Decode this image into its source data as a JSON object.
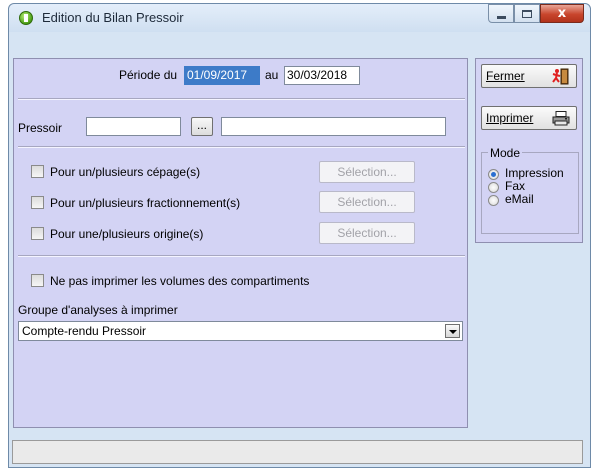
{
  "window": {
    "title": "Edition du Bilan Pressoir",
    "close_glyph": "x"
  },
  "periode": {
    "label_du": "Période du",
    "date_from": "01/09/2017",
    "label_au": "au",
    "date_to": "30/03/2018"
  },
  "pressoir": {
    "label": "Pressoir",
    "code_value": "",
    "browse_label": "...",
    "name_value": ""
  },
  "filters": [
    {
      "label": "Pour un/plusieurs cépage(s)",
      "button": "Sélection...",
      "checked": false
    },
    {
      "label": "Pour un/plusieurs fractionnement(s)",
      "button": "Sélection...",
      "checked": false
    },
    {
      "label": "Pour une/plusieurs origine(s)",
      "button": "Sélection...",
      "checked": false
    }
  ],
  "no_volumes": {
    "label": "Ne pas imprimer les volumes des compartiments",
    "checked": false
  },
  "groupe": {
    "label": "Groupe d'analyses à imprimer",
    "selected": "Compte-rendu Pressoir"
  },
  "actions": {
    "fermer_label": "Fermer",
    "imprimer_label": "Imprimer",
    "fermer_icon": "exit-door-icon",
    "imprimer_icon": "printer-icon"
  },
  "mode": {
    "title": "Mode",
    "options": [
      "Impression",
      "Fax",
      "eMail"
    ],
    "selected": "Impression"
  },
  "colors": {
    "panel": "#d3d3f4",
    "window": "#d6e4f3",
    "selection": "#3d7bc8"
  }
}
